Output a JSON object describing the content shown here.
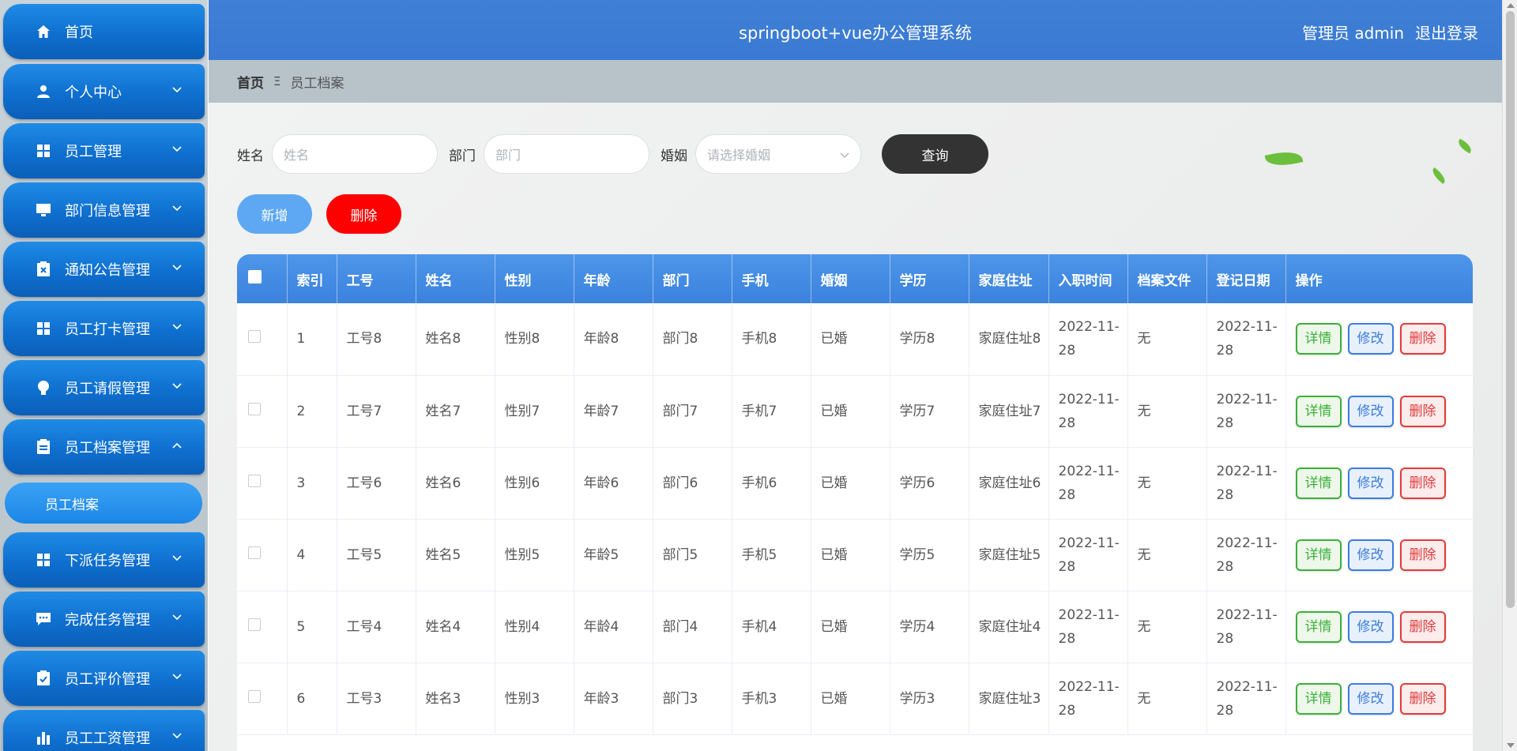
{
  "header": {
    "title": "springboot+vue办公管理系统",
    "user": "管理员 admin",
    "logout": "退出登录"
  },
  "sidebar": {
    "items": [
      {
        "label": "首页",
        "icon": "home-icon"
      },
      {
        "label": "个人中心",
        "icon": "user-icon"
      },
      {
        "label": "员工管理",
        "icon": "grid-icon"
      },
      {
        "label": "部门信息管理",
        "icon": "monitor-icon"
      },
      {
        "label": "通知公告管理",
        "icon": "clipboard-x-icon"
      },
      {
        "label": "员工打卡管理",
        "icon": "grid-icon"
      },
      {
        "label": "员工请假管理",
        "icon": "bulb-icon"
      },
      {
        "label": "员工档案管理",
        "icon": "document-icon"
      },
      {
        "label": "下派任务管理",
        "icon": "grid-icon"
      },
      {
        "label": "完成任务管理",
        "icon": "chat-icon"
      },
      {
        "label": "员工评价管理",
        "icon": "clipboard-check-icon"
      },
      {
        "label": "员工工资管理",
        "icon": "bar-chart-icon"
      }
    ],
    "active_sub": "员工档案"
  },
  "breadcrumb": {
    "home": "首页",
    "separator": "Ξ",
    "current": "员工档案"
  },
  "search": {
    "name_label": "姓名",
    "name_placeholder": "姓名",
    "dept_label": "部门",
    "dept_placeholder": "部门",
    "marriage_label": "婚姻",
    "marriage_placeholder": "请选择婚姻",
    "query_label": "查询"
  },
  "actions": {
    "add_label": "新增",
    "delete_label": "删除"
  },
  "table": {
    "columns": [
      "",
      "索引",
      "工号",
      "姓名",
      "性别",
      "年龄",
      "部门",
      "手机",
      "婚姻",
      "学历",
      "家庭住址",
      "入职时间",
      "档案文件",
      "登记日期",
      "操作"
    ],
    "rows": [
      {
        "idx": "1",
        "no": "工号8",
        "name": "姓名8",
        "sex": "性别8",
        "age": "年龄8",
        "dept": "部门8",
        "phone": "手机8",
        "marriage": "已婚",
        "edu": "学历8",
        "addr": "家庭住址8",
        "hire": "2022-11-28",
        "file": "无",
        "reg": "2022-11-28"
      },
      {
        "idx": "2",
        "no": "工号7",
        "name": "姓名7",
        "sex": "性别7",
        "age": "年龄7",
        "dept": "部门7",
        "phone": "手机7",
        "marriage": "已婚",
        "edu": "学历7",
        "addr": "家庭住址7",
        "hire": "2022-11-28",
        "file": "无",
        "reg": "2022-11-28"
      },
      {
        "idx": "3",
        "no": "工号6",
        "name": "姓名6",
        "sex": "性别6",
        "age": "年龄6",
        "dept": "部门6",
        "phone": "手机6",
        "marriage": "已婚",
        "edu": "学历6",
        "addr": "家庭住址6",
        "hire": "2022-11-28",
        "file": "无",
        "reg": "2022-11-28"
      },
      {
        "idx": "4",
        "no": "工号5",
        "name": "姓名5",
        "sex": "性别5",
        "age": "年龄5",
        "dept": "部门5",
        "phone": "手机5",
        "marriage": "已婚",
        "edu": "学历5",
        "addr": "家庭住址5",
        "hire": "2022-11-28",
        "file": "无",
        "reg": "2022-11-28"
      },
      {
        "idx": "5",
        "no": "工号4",
        "name": "姓名4",
        "sex": "性别4",
        "age": "年龄4",
        "dept": "部门4",
        "phone": "手机4",
        "marriage": "已婚",
        "edu": "学历4",
        "addr": "家庭住址4",
        "hire": "2022-11-28",
        "file": "无",
        "reg": "2022-11-28"
      },
      {
        "idx": "6",
        "no": "工号3",
        "name": "姓名3",
        "sex": "性别3",
        "age": "年龄3",
        "dept": "部门3",
        "phone": "手机3",
        "marriage": "已婚",
        "edu": "学历3",
        "addr": "家庭住址3",
        "hire": "2022-11-28",
        "file": "无",
        "reg": "2022-11-28"
      }
    ],
    "op_detail": "详情",
    "op_edit": "修改",
    "op_delete": "删除"
  },
  "colors": {
    "accent": "#3f7fd6",
    "sidebar_item": "#0f6fcf",
    "danger": "#ff0000",
    "query": "#333333"
  }
}
